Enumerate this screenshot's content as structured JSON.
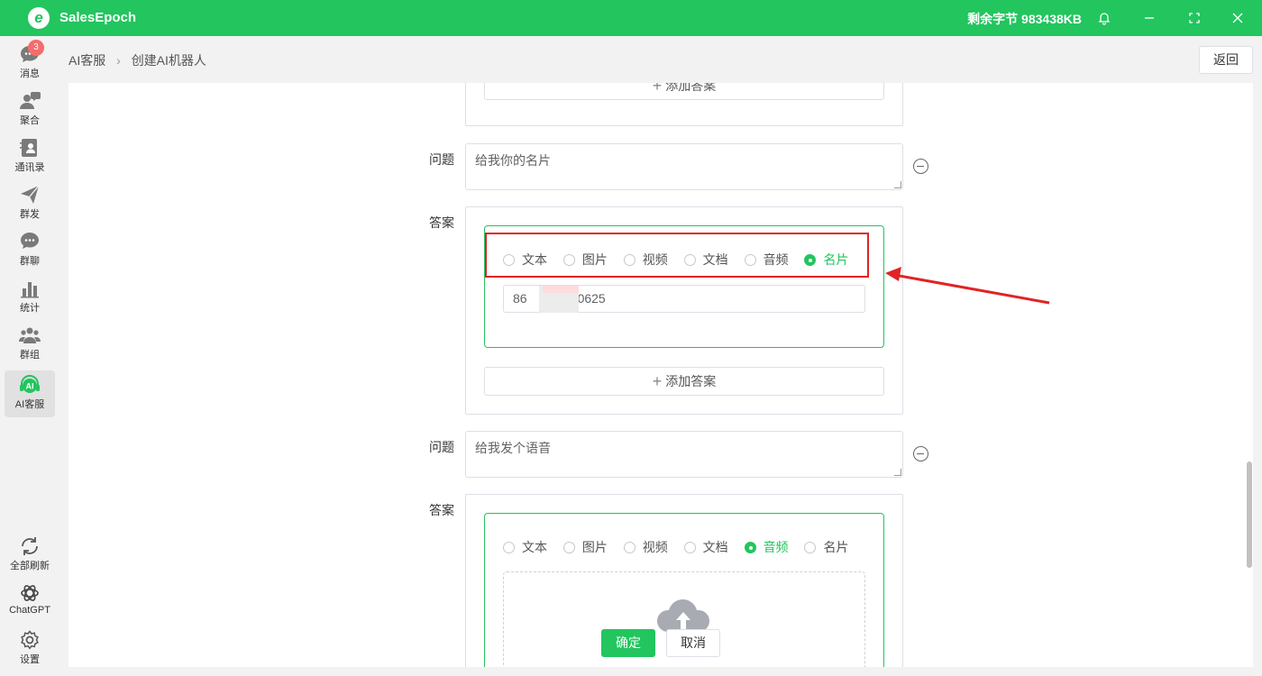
{
  "app": {
    "name": "SalesEpoch",
    "logo_letter": "e",
    "remaining_bytes": "剩余字节 983438KB"
  },
  "window_controls": [
    "bell-icon",
    "minimize-icon",
    "maximize-icon",
    "close-icon"
  ],
  "sidebar": {
    "items": [
      {
        "label": "消息",
        "icon": "chat-bubble-icon",
        "badge": "3"
      },
      {
        "label": "聚合",
        "icon": "users-chat-icon"
      },
      {
        "label": "通讯录",
        "icon": "contacts-icon"
      },
      {
        "label": "群发",
        "icon": "send-icon"
      },
      {
        "label": "群聊",
        "icon": "group-chat-icon"
      },
      {
        "label": "统计",
        "icon": "bar-chart-icon"
      },
      {
        "label": "群组",
        "icon": "group-icon"
      },
      {
        "label": "AI客服",
        "icon": "ai-headset-icon",
        "active": true
      }
    ],
    "bottom": [
      {
        "label": "全部刷新",
        "icon": "refresh-icon"
      },
      {
        "label": "ChatGPT",
        "icon": "openai-icon"
      },
      {
        "label": "设置",
        "icon": "settings-icon"
      }
    ]
  },
  "breadcrumb": {
    "root": "AI客服",
    "current": "创建AI机器人"
  },
  "back_label": "返回",
  "form": {
    "top_add_answer": "添加答案",
    "qa": [
      {
        "question_label": "问题",
        "question": "给我你的名片",
        "answer_label": "答案",
        "answer_types": [
          "文本",
          "图片",
          "视频",
          "文档",
          "音频",
          "名片"
        ],
        "selected": "名片",
        "card_value_start": "86",
        "card_value_end": "0625",
        "add_answer": "添加答案"
      },
      {
        "question_label": "问题",
        "question": "给我发个语音",
        "answer_label": "答案",
        "answer_types": [
          "文本",
          "图片",
          "视频",
          "文档",
          "音频",
          "名片"
        ],
        "selected": "音频"
      }
    ]
  },
  "footer": {
    "confirm": "确定",
    "cancel": "取消"
  },
  "colors": {
    "accent": "#22c55e",
    "highlight": "#e02424"
  }
}
